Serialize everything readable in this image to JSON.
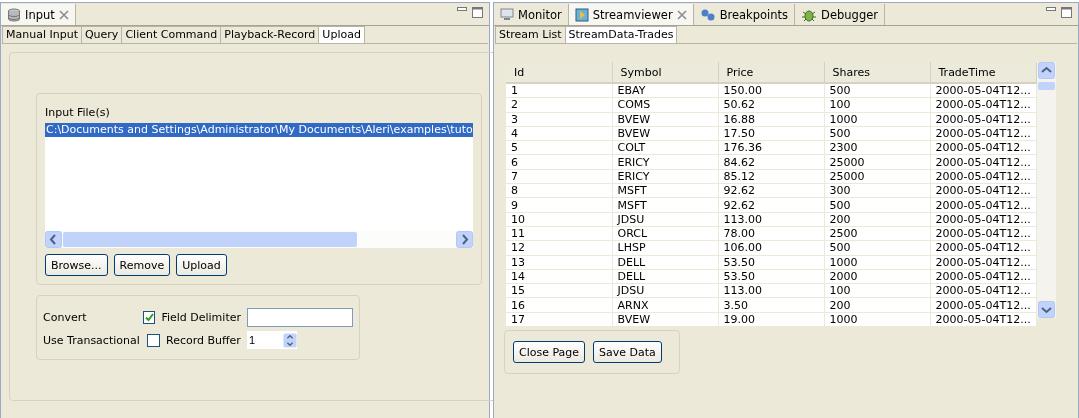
{
  "input_view": {
    "tab": {
      "title": "Input",
      "selected": true
    },
    "subtabs": [
      {
        "label": "Manual Input",
        "selected": false
      },
      {
        "label": "Query",
        "selected": false
      },
      {
        "label": "Client Command",
        "selected": false
      },
      {
        "label": "Playback-Record",
        "selected": false
      },
      {
        "label": "Upload",
        "selected": true
      }
    ],
    "input_files": {
      "label": "Input File(s)",
      "files": [
        {
          "path": "C:\\Documents and Settings\\Administrator\\My Documents\\Aleri\\examples\\tuto",
          "selected": true
        }
      ]
    },
    "file_buttons": [
      "Browse...",
      "Remove",
      "Upload"
    ],
    "options": [
      {
        "label": "Convert",
        "checked": true,
        "field_label": "Field Delimiter",
        "kind": "text"
      },
      {
        "label": "Use Transactional",
        "checked": false,
        "field_label": "Record Buffer",
        "kind": "spinner",
        "value": "1"
      }
    ]
  },
  "stream_view": {
    "tabs": [
      {
        "label": "Monitor",
        "selected": false,
        "closable": false
      },
      {
        "label": "Streamviewer",
        "selected": true,
        "closable": true
      },
      {
        "label": "Breakpoints",
        "selected": false,
        "closable": false
      },
      {
        "label": "Debugger",
        "selected": false,
        "closable": false
      }
    ],
    "subtabs": [
      {
        "label": "Stream List",
        "selected": false
      },
      {
        "label": "StreamData-Trades",
        "selected": true
      }
    ],
    "table": {
      "columns": [
        "Id",
        "Symbol",
        "Price",
        "Shares",
        "TradeTime"
      ],
      "rows": [
        [
          "1",
          "EBAY",
          "150.00",
          "500",
          "2000-05-04T12..."
        ],
        [
          "2",
          "COMS",
          "50.62",
          "100",
          "2000-05-04T12..."
        ],
        [
          "3",
          "BVEW",
          "16.88",
          "1000",
          "2000-05-04T12..."
        ],
        [
          "4",
          "BVEW",
          "17.50",
          "500",
          "2000-05-04T12..."
        ],
        [
          "5",
          "COLT",
          "176.36",
          "2300",
          "2000-05-04T12..."
        ],
        [
          "6",
          "ERICY",
          "84.62",
          "25000",
          "2000-05-04T12..."
        ],
        [
          "7",
          "ERICY",
          "85.12",
          "25000",
          "2000-05-04T12..."
        ],
        [
          "8",
          "MSFT",
          "92.62",
          "300",
          "2000-05-04T12..."
        ],
        [
          "9",
          "MSFT",
          "92.62",
          "500",
          "2000-05-04T12..."
        ],
        [
          "10",
          "JDSU",
          "113.00",
          "200",
          "2000-05-04T12..."
        ],
        [
          "11",
          "ORCL",
          "78.00",
          "2500",
          "2000-05-04T12..."
        ],
        [
          "12",
          "LHSP",
          "106.00",
          "500",
          "2000-05-04T12..."
        ],
        [
          "13",
          "DELL",
          "53.50",
          "1000",
          "2000-05-04T12..."
        ],
        [
          "14",
          "DELL",
          "53.50",
          "2000",
          "2000-05-04T12..."
        ],
        [
          "15",
          "JDSU",
          "113.00",
          "100",
          "2000-05-04T12..."
        ],
        [
          "16",
          "ARNX",
          "3.50",
          "200",
          "2000-05-04T12..."
        ],
        [
          "17",
          "BVEW",
          "19.00",
          "1000",
          "2000-05-04T12..."
        ]
      ]
    },
    "buttons": [
      "Close Page",
      "Save Data"
    ]
  }
}
